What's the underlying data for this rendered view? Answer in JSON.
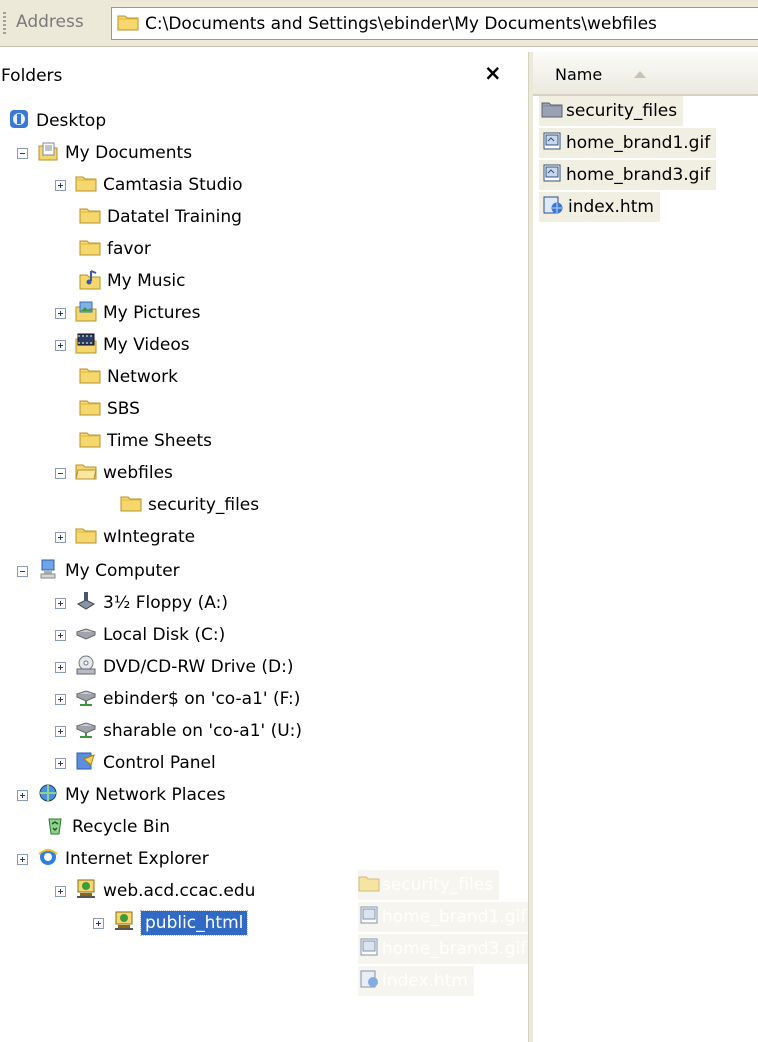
{
  "address": {
    "label": "Address",
    "path": "C:\\Documents and Settings\\ebinder\\My Documents\\webfiles"
  },
  "folders_pane": {
    "title": "Folders",
    "close_symbol": "×",
    "tree": [
      {
        "label": "Desktop",
        "icon": "desktop-icon"
      },
      {
        "label": "My Documents",
        "icon": "my-documents-icon",
        "expander": "minus"
      },
      {
        "label": "Camtasia Studio",
        "icon": "folder-icon",
        "expander": "plus"
      },
      {
        "label": "Datatel Training",
        "icon": "folder-icon"
      },
      {
        "label": "favor",
        "icon": "folder-icon"
      },
      {
        "label": "My Music",
        "icon": "music-folder-icon"
      },
      {
        "label": "My Pictures",
        "icon": "pictures-folder-icon",
        "expander": "plus"
      },
      {
        "label": "My Videos",
        "icon": "videos-folder-icon",
        "expander": "plus"
      },
      {
        "label": "Network",
        "icon": "folder-icon"
      },
      {
        "label": "SBS",
        "icon": "folder-icon"
      },
      {
        "label": "Time Sheets",
        "icon": "folder-icon"
      },
      {
        "label": "webfiles",
        "icon": "open-folder-icon",
        "expander": "minus"
      },
      {
        "label": "security_files",
        "icon": "folder-icon"
      },
      {
        "label": "wIntegrate",
        "icon": "folder-icon",
        "expander": "plus"
      },
      {
        "label": "My Computer",
        "icon": "computer-icon",
        "expander": "minus"
      },
      {
        "label": "3½ Floppy (A:)",
        "icon": "floppy-icon",
        "expander": "plus"
      },
      {
        "label": "Local Disk (C:)",
        "icon": "disk-icon",
        "expander": "plus"
      },
      {
        "label": "DVD/CD-RW Drive (D:)",
        "icon": "cd-drive-icon",
        "expander": "plus"
      },
      {
        "label": "ebinder$ on 'co-a1' (F:)",
        "icon": "network-drive-icon",
        "expander": "plus"
      },
      {
        "label": "sharable on 'co-a1' (U:)",
        "icon": "network-drive-icon",
        "expander": "plus"
      },
      {
        "label": "Control Panel",
        "icon": "control-panel-icon",
        "expander": "plus"
      },
      {
        "label": "My Network Places",
        "icon": "network-places-icon",
        "expander": "plus"
      },
      {
        "label": "Recycle Bin",
        "icon": "recycle-bin-icon"
      },
      {
        "label": "Internet Explorer",
        "icon": "internet-explorer-icon",
        "expander": "plus"
      },
      {
        "label": "web.acd.ccac.edu",
        "icon": "ftp-site-icon",
        "expander": "plus"
      },
      {
        "label": "public_html",
        "icon": "ftp-site-icon",
        "expander": "plus",
        "selected": true
      }
    ]
  },
  "file_list": {
    "column_name": "Name",
    "files": [
      {
        "label": "security_files",
        "icon": "folder-icon"
      },
      {
        "label": "home_brand1.gif",
        "icon": "gif-file-icon"
      },
      {
        "label": "home_brand3.gif",
        "icon": "gif-file-icon"
      },
      {
        "label": "index.htm",
        "icon": "htm-file-icon"
      }
    ]
  },
  "drag_ghost": {
    "items": [
      {
        "label": "security_files",
        "icon": "folder-icon"
      },
      {
        "label": "home_brand1.gif",
        "icon": "gif-file-icon"
      },
      {
        "label": "home_brand3.gif",
        "icon": "gif-file-icon"
      },
      {
        "label": "index.htm",
        "icon": "htm-file-icon"
      }
    ]
  },
  "colors": {
    "selection": "#316ac5",
    "toolbar": "#ece9d8",
    "folder": "#f5d76e"
  }
}
